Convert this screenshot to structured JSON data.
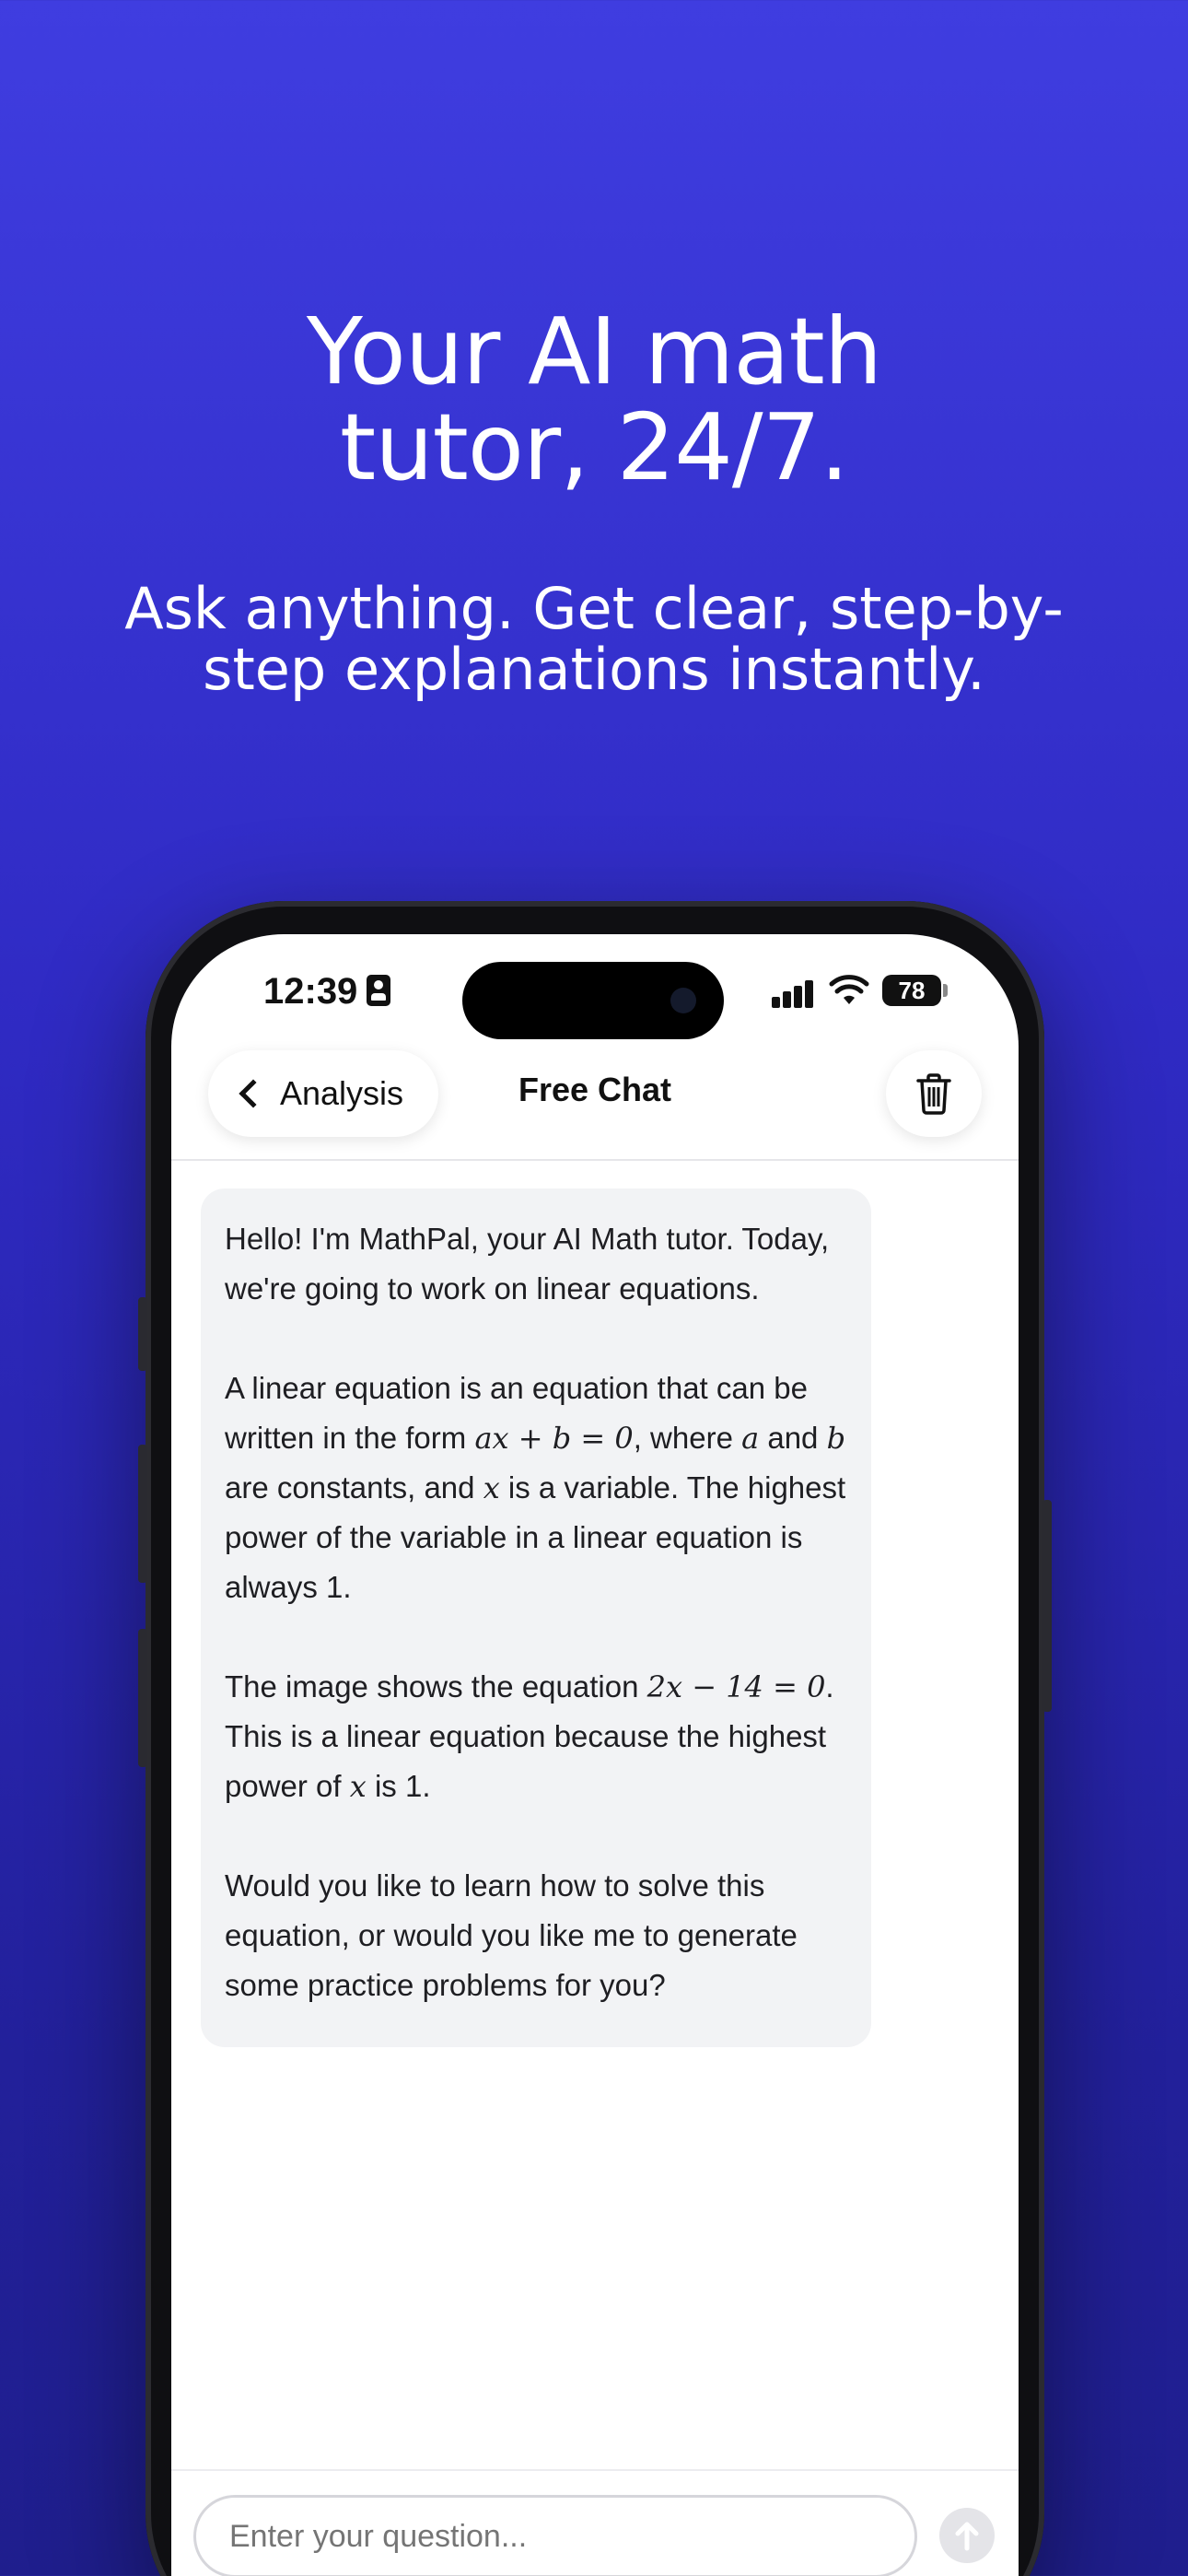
{
  "marketing": {
    "headline_line1": "Your AI math",
    "headline_line2": "tutor, 24/7.",
    "subhead_line1": "Ask anything. Get clear, step-by-",
    "subhead_line2": "step explanations instantly."
  },
  "status_bar": {
    "time": "12:39",
    "battery": "78",
    "icons": [
      "id-badge-icon",
      "cellular-signal-icon",
      "wifi-icon",
      "battery-icon"
    ]
  },
  "nav": {
    "back_label": "Analysis",
    "title": "Free Chat",
    "trash_icon": "trash-icon"
  },
  "chat": {
    "message": {
      "p1": "Hello! I'm MathPal, your AI Math tutor. Today, we're going to work on linear equations.",
      "p2_a": "A linear equation is an equation that can be written in the form ",
      "p2_m1": "ax + b = 0",
      "p2_b": ", where ",
      "p2_m2": "a",
      "p2_c": " and ",
      "p2_m3": "b",
      "p2_d": " are constants, and ",
      "p2_m4": "x",
      "p2_e": " is a variable. The highest power of the variable in a linear equation is always 1.",
      "p3_a": "The image shows the equation ",
      "p3_m1": "2x − 14 = 0",
      "p3_b": ". This is a linear equation because the highest power of ",
      "p3_m2": "x",
      "p3_c": " is 1.",
      "p4": "Would you like to learn how to solve this equation, or would you like me to generate some practice problems for you?"
    }
  },
  "composer": {
    "placeholder": "Enter your question..."
  },
  "colors": {
    "bg_top": "#3f3de0",
    "bg_bottom": "#1f1e8d",
    "bubble": "#f2f3f5"
  }
}
